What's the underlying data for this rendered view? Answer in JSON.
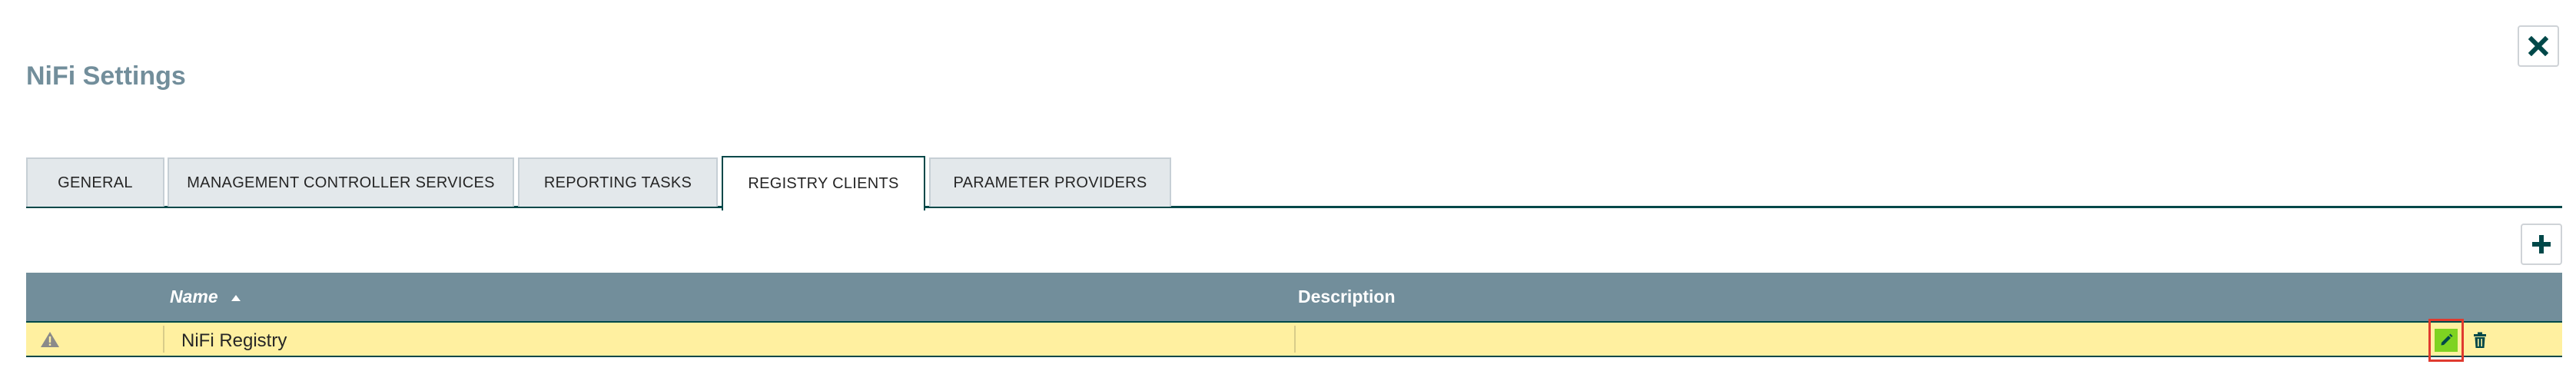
{
  "dialog": {
    "title": "NiFi Settings",
    "close_icon": "close-icon"
  },
  "tabs": [
    {
      "label": "GENERAL",
      "active": false
    },
    {
      "label": "MANAGEMENT CONTROLLER SERVICES",
      "active": false
    },
    {
      "label": "REPORTING TASKS",
      "active": false
    },
    {
      "label": "REGISTRY CLIENTS",
      "active": true
    },
    {
      "label": "PARAMETER PROVIDERS",
      "active": false
    }
  ],
  "toolbar": {
    "add_icon": "plus-icon"
  },
  "table": {
    "columns": {
      "name": "Name",
      "description": "Description"
    },
    "sort": {
      "column": "Name",
      "direction": "ascending"
    },
    "rows": [
      {
        "status_icon": "warning-icon",
        "name": "NiFi Registry",
        "description": "",
        "actions": [
          "pencil-icon",
          "trash-icon"
        ]
      }
    ]
  },
  "colors": {
    "title": "#728e9b",
    "header_bg": "#728e9b",
    "row_bg": "#fff0a0",
    "accent": "#004849",
    "edit_bg": "#7ed321",
    "highlight": "#e03a2f"
  }
}
